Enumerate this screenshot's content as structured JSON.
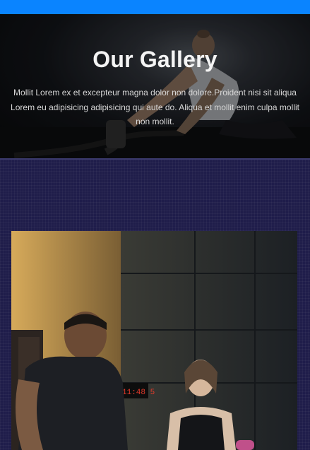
{
  "header": {
    "title": "Our Gallery",
    "description": "Mollit Lorem ex et excepteur magna dolor non dolore.Proident nisi sit aliqua Lorem eu adipisicing adipisicing qui aute do. Aliqua et mollit enim culpa mollit non mollit."
  },
  "gallery": {
    "photo_clock_text": "11:48 5"
  },
  "colors": {
    "topbar": "#0a84ff",
    "section_bg": "#1f1d4a"
  }
}
